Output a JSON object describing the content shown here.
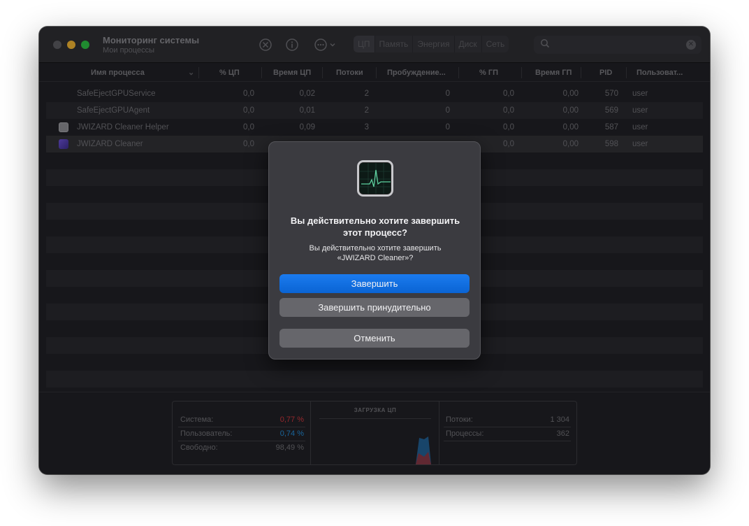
{
  "app": {
    "title": "Мониторинг системы",
    "subtitle": "Мои процессы"
  },
  "toolbar": {
    "stop_icon": "stop-x-icon",
    "info_icon": "info-icon",
    "more_icon": "ellipsis-icon",
    "tabs": [
      {
        "label": "ЦП",
        "active": true
      },
      {
        "label": "Память",
        "active": false
      },
      {
        "label": "Энергия",
        "active": false
      },
      {
        "label": "Диск",
        "active": false
      },
      {
        "label": "Сеть",
        "active": false
      }
    ],
    "search": {
      "value": "",
      "placeholder": ""
    }
  },
  "columns": {
    "name": "Имя процесса",
    "cpu": "% ЦП",
    "cpu_time": "Время ЦП",
    "threads": "Потоки",
    "wakeups": "Пробуждение...",
    "gpu": "% ГП",
    "gpu_time": "Время ГП",
    "pid": "PID",
    "user": "Пользоват..."
  },
  "processes": [
    {
      "name": "SafeEjectGPUService",
      "cpu": "0,0",
      "cpu_time": "0,02",
      "threads": "2",
      "wakeups": "0",
      "gpu": "0,0",
      "gpu_time": "0,00",
      "pid": "570",
      "user": "user"
    },
    {
      "name": "SafeEjectGPUAgent",
      "cpu": "0,0",
      "cpu_time": "0,01",
      "threads": "2",
      "wakeups": "0",
      "gpu": "0,0",
      "gpu_time": "0,00",
      "pid": "569",
      "user": "user"
    },
    {
      "name": "JWIZARD Cleaner Helper",
      "cpu": "0,0",
      "cpu_time": "0,09",
      "threads": "3",
      "wakeups": "0",
      "gpu": "0,0",
      "gpu_time": "0,00",
      "pid": "587",
      "user": "user"
    },
    {
      "name": "JWIZARD Cleaner",
      "cpu": "0,0",
      "cpu_time": "",
      "threads": "",
      "wakeups": "",
      "gpu": "0,0",
      "gpu_time": "0,00",
      "pid": "598",
      "user": "user"
    }
  ],
  "stats": {
    "system_label": "Система:",
    "system_value": "0,77 %",
    "user_label": "Пользователь:",
    "user_value": "0,74 %",
    "idle_label": "Свободно:",
    "idle_value": "98,49 %",
    "cpu_load_title": "ЗАГРУЗКА ЦП",
    "threads_label": "Потоки:",
    "threads_value": "1 304",
    "processes_label": "Процессы:",
    "processes_value": "362"
  },
  "dialog": {
    "title": "Вы действительно хотите завершить этот процесс?",
    "message_line1": "Вы действительно хотите завершить",
    "message_line2": "«JWIZARD Cleaner»?",
    "quit_label": "Завершить",
    "force_quit_label": "Завершить принудительно",
    "cancel_label": "Отменить",
    "icon": "activity-monitor-icon"
  },
  "colors": {
    "accent": "#0a64d4",
    "system": "#d0343a",
    "user": "#1f8ad6"
  }
}
